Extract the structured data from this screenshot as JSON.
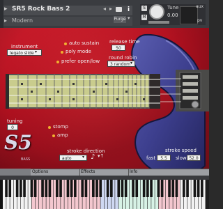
{
  "header": {
    "instrument_name": "SR5 Rock Bass 2",
    "preset_name": "Modern",
    "purge_label": "Purge",
    "tune_label": "Tune",
    "tune_value": "0.00",
    "solo_label": "S",
    "mute_label": "M",
    "aux_label": "aux",
    "pv_label": "pv"
  },
  "controls": {
    "instrument_label": "instrument",
    "instrument_value": "legato slide",
    "auto_sustain": "auto sustain",
    "poly_mode": "poly mode",
    "prefer_open_low": "prefer open/low",
    "release_time_label": "release time",
    "release_time_value": "50",
    "round_robin_label": "round robin",
    "round_robin_value": "3 random"
  },
  "lower": {
    "tuning_label": "tuning",
    "tuning_value": "0",
    "stomp": "stomp",
    "amp": "amp",
    "logo_text": "S5",
    "logo_sub": "BASS",
    "stroke_direction_label": "stroke direction",
    "stroke_direction_value": "auto",
    "stroke_speed_label": "stroke speed",
    "fast_label": "fast",
    "fast_value": "5.5",
    "slow_label": "slow",
    "slow_value": "52.0"
  },
  "tabs": [
    {
      "label": ""
    },
    {
      "label": "Options"
    },
    {
      "label": "Effects"
    },
    {
      "label": "Info"
    }
  ],
  "colors": {
    "body_red": "#c91b2a",
    "fretboard": "#c9cc8d",
    "accent_dot": "#f0b030",
    "guitar_blue": "#3d3f8e"
  },
  "icons": [
    "camera-icon",
    "info-icon",
    "note-icon"
  ]
}
